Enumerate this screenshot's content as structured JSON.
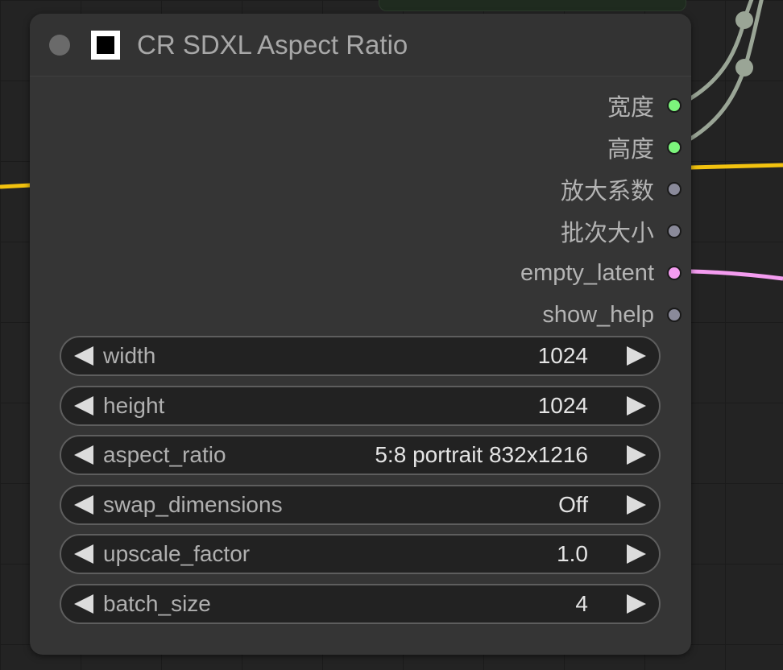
{
  "node": {
    "title": "CR SDXL Aspect Ratio",
    "title_color": "#a8a8a8"
  },
  "outputs": [
    {
      "label": "宽度",
      "color": "#7cf47c"
    },
    {
      "label": "高度",
      "color": "#7cf47c"
    },
    {
      "label": "放大系数",
      "color": "#8a8a9a"
    },
    {
      "label": "批次大小",
      "color": "#8a8a9a"
    },
    {
      "label": "empty_latent",
      "color": "#f49cf0"
    },
    {
      "label": "show_help",
      "color": "#8a8a9a"
    }
  ],
  "widgets": [
    {
      "name": "width",
      "value": "1024"
    },
    {
      "name": "height",
      "value": "1024"
    },
    {
      "name": "aspect_ratio",
      "value": "5:8 portrait 832x1216"
    },
    {
      "name": "swap_dimensions",
      "value": "Off"
    },
    {
      "name": "upscale_factor",
      "value": "1.0"
    },
    {
      "name": "batch_size",
      "value": "4"
    }
  ],
  "colors": {
    "canvas_bg": "#232323",
    "node_bg": "#353535",
    "widget_bg": "#222222",
    "link_yellow": "#f2c20f",
    "link_pink": "#f49cf0",
    "link_gray": "#9aa596"
  }
}
